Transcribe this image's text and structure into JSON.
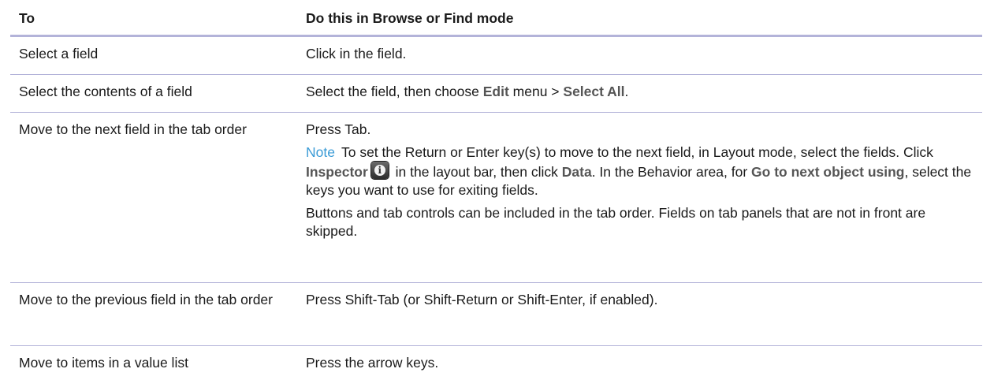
{
  "header": {
    "col1": "To",
    "col2": "Do this in Browse or Find mode"
  },
  "rows": [
    {
      "action": "Select a field",
      "how": "Click in the field."
    },
    {
      "action": "Select the contents of a field",
      "how_pre": "Select the field, then choose ",
      "how_menu": "Edit",
      "how_mid": " menu > ",
      "how_item": "Select All",
      "how_post": "."
    },
    {
      "action": "Move to the next field in the tab order",
      "how": "Press Tab.",
      "note_label": "Note",
      "note_1": "To set the Return or Enter key(s) to move to the next field, in Layout mode, select the fields. Click ",
      "note_inspector": "Inspector",
      "note_2": " in the layout bar, then click ",
      "note_data": "Data",
      "note_3": ". In the Behavior area, for ",
      "note_goto": "Go to next object using",
      "note_4": ", select the keys you want to use for exiting fields.",
      "extra": "Buttons and tab controls can be included in the tab order. Fields on tab panels that are not in front are skipped.",
      "icon": "inspector-info-icon"
    },
    {
      "action": "Move to the previous field in the tab order",
      "how": "Press Shift-Tab (or Shift-Return or Shift-Enter, if enabled)."
    },
    {
      "action": "Move to items in a value list",
      "how": "Press the arrow keys."
    }
  ],
  "colors": {
    "rule": "#b3b3d9",
    "note": "#3a9bd6",
    "ui_term": "#555555"
  }
}
